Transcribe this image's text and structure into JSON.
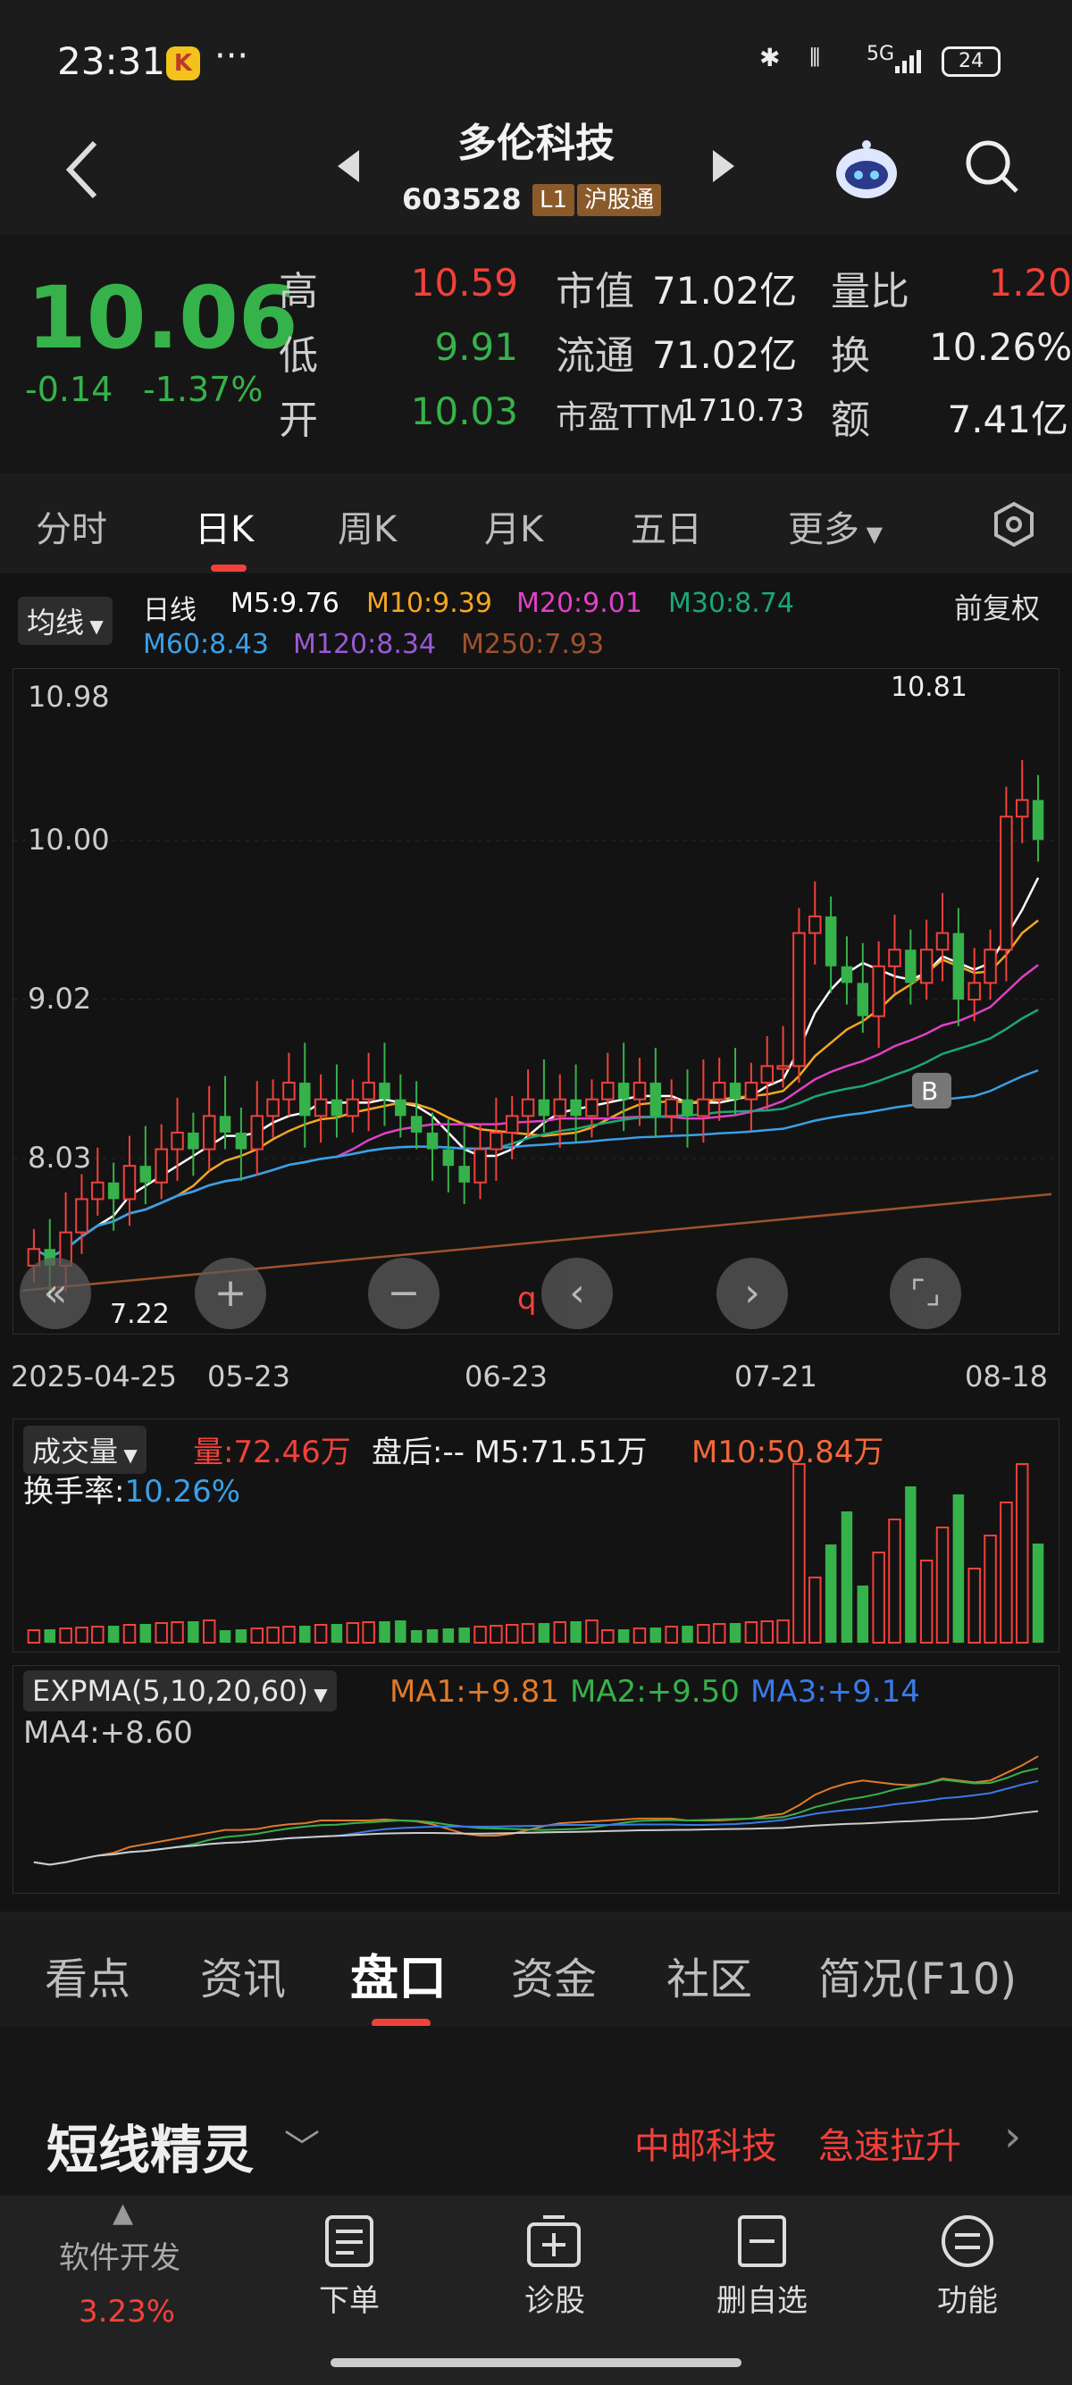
{
  "status_bar": {
    "time": "23:31",
    "app_badge": "K",
    "more": "···",
    "network": "5G",
    "battery": "24"
  },
  "header": {
    "stock_name": "多伦科技",
    "stock_code": "603528",
    "level_tag": "L1",
    "connect_tag": "沪股通"
  },
  "quote": {
    "price": "10.06",
    "change": "-0.14",
    "change_pct": "-1.37%",
    "high_label": "高",
    "high": "10.59",
    "low_label": "低",
    "low": "9.91",
    "open_label": "开",
    "open": "10.03",
    "mcap_label": "市值",
    "mcap": "71.02亿",
    "float_label": "流通",
    "float": "71.02亿",
    "pe_label": "市盈TTM",
    "pe": "1710.73",
    "vol_ratio_label": "量比",
    "vol_ratio": "1.20",
    "turnover_label": "换",
    "turnover": "10.26%",
    "amount_label": "额",
    "amount": "7.41亿"
  },
  "tabs": [
    "分时",
    "日K",
    "周K",
    "月K",
    "五日",
    "更多"
  ],
  "active_tab": 1,
  "ma_legend": {
    "selector": "均线",
    "period": "日线",
    "m5": "M5:9.76",
    "m10": "M10:9.39",
    "m20": "M20:9.01",
    "m30": "M30:8.74",
    "m60": "M60:8.43",
    "m120": "M120:8.34",
    "m250": "M250:7.93",
    "adjust": "前复权"
  },
  "kline": {
    "y_labels": [
      "10.98",
      "10.00",
      "9.02",
      "8.03"
    ],
    "high_marker": "10.81",
    "low_marker": "7.22",
    "x_labels": [
      "2025-04-25",
      "05-23",
      "06-23",
      "07-21",
      "08-18"
    ],
    "b_marker": "B",
    "q_marker": "q"
  },
  "volume_panel": {
    "selector": "成交量",
    "vol": "量:72.46万",
    "after": "盘后:-- M5:71.51万",
    "m10": "M10:50.84万",
    "turnover": "换手率:",
    "turnover_val": "10.26%"
  },
  "expma_panel": {
    "selector": "EXPMA(5,10,20,60)",
    "ma1": "MA1:+9.81",
    "ma2": "MA2:+9.50",
    "ma3": "MA3:+9.14",
    "ma4": "MA4:+8.60"
  },
  "bottom_tabs": [
    "看点",
    "资讯",
    "盘口",
    "资金",
    "社区",
    "简况(F10)"
  ],
  "active_bottom_tab": 2,
  "sprite": {
    "title": "短线精灵",
    "stock": "中邮科技",
    "event": "急速拉升"
  },
  "navbar": {
    "sector": "软件开发",
    "sector_pct": "3.23%",
    "items": [
      "下单",
      "诊股",
      "删自选",
      "功能"
    ]
  },
  "colors": {
    "up": "#f2413a",
    "down": "#36b24a",
    "m5": "#ffffff",
    "m10": "#f5a623",
    "m20": "#e040c8",
    "m30": "#1aa779",
    "m60": "#3aa0e8",
    "m120": "#9b59d6",
    "m250": "#a0522d"
  },
  "chart_data": {
    "type": "candlestick",
    "x_ticks": [
      "2025-04-25",
      "05-23",
      "06-23",
      "07-21",
      "08-18"
    ],
    "ylim": [
      7.22,
      10.98
    ],
    "closes": [
      7.6,
      7.5,
      7.7,
      7.9,
      8.0,
      7.9,
      8.1,
      8.0,
      8.2,
      8.3,
      8.2,
      8.4,
      8.3,
      8.2,
      8.4,
      8.5,
      8.6,
      8.4,
      8.5,
      8.4,
      8.5,
      8.6,
      8.5,
      8.4,
      8.3,
      8.2,
      8.1,
      8.0,
      8.2,
      8.3,
      8.4,
      8.5,
      8.4,
      8.5,
      8.4,
      8.5,
      8.6,
      8.5,
      8.6,
      8.4,
      8.5,
      8.4,
      8.5,
      8.6,
      8.5,
      8.6,
      8.7,
      8.7,
      9.5,
      9.6,
      9.3,
      9.2,
      9.0,
      9.3,
      9.4,
      9.2,
      9.4,
      9.5,
      9.1,
      9.2,
      9.4,
      10.2,
      10.3,
      10.06
    ]
  }
}
